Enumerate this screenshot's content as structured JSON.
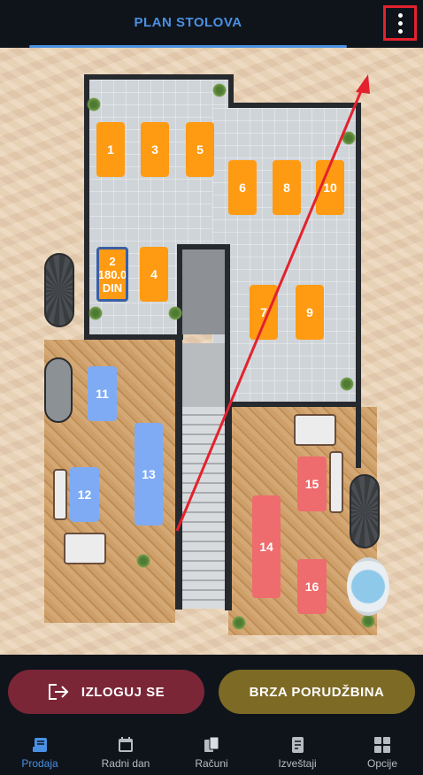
{
  "header": {
    "title": "PLAN STOLOVA",
    "menu_icon": "more-vert-icon"
  },
  "tables": [
    {
      "id": "1",
      "label": "1",
      "color": "#ff9b12"
    },
    {
      "id": "2",
      "label": "2",
      "amount": "180.0",
      "currency": "DIN",
      "color": "#ff9b12",
      "selected": true
    },
    {
      "id": "3",
      "label": "3",
      "color": "#ff9b12"
    },
    {
      "id": "4",
      "label": "4",
      "color": "#ff9b12"
    },
    {
      "id": "5",
      "label": "5",
      "color": "#ff9b12"
    },
    {
      "id": "6",
      "label": "6",
      "color": "#ff9b12"
    },
    {
      "id": "7",
      "label": "7",
      "color": "#ff9b12"
    },
    {
      "id": "8",
      "label": "8",
      "color": "#ff9b12"
    },
    {
      "id": "9",
      "label": "9",
      "color": "#ff9b12"
    },
    {
      "id": "10",
      "label": "10",
      "color": "#ff9b12"
    },
    {
      "id": "11",
      "label": "11",
      "color": "#7fabf4"
    },
    {
      "id": "12",
      "label": "12",
      "color": "#7fabf4"
    },
    {
      "id": "13",
      "label": "13",
      "color": "#7fabf4"
    },
    {
      "id": "14",
      "label": "14",
      "color": "#ee6b6e"
    },
    {
      "id": "15",
      "label": "15",
      "color": "#ee6b6e"
    },
    {
      "id": "16",
      "label": "16",
      "color": "#ee6b6e"
    }
  ],
  "actions": {
    "logout_label": "IZLOGUJ SE",
    "quick_order_label": "BRZA PORUDŽBINA"
  },
  "nav": [
    {
      "label": "Prodaja",
      "icon": "receipt-icon",
      "active": true
    },
    {
      "label": "Radni dan",
      "icon": "calendar-icon",
      "active": false
    },
    {
      "label": "Računi",
      "icon": "documents-icon",
      "active": false
    },
    {
      "label": "Izveštaji",
      "icon": "report-icon",
      "active": false
    },
    {
      "label": "Opcije",
      "icon": "grid-icon",
      "active": false
    }
  ],
  "colors": {
    "accent": "#4a90e2",
    "logout": "#7a2637",
    "quick_order": "#7d6a25",
    "highlight": "#e3222e"
  }
}
